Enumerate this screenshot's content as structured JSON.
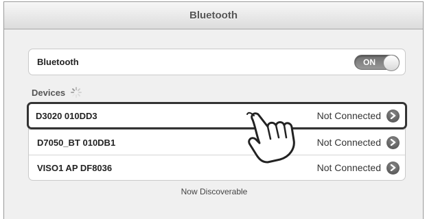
{
  "nav": {
    "title": "Bluetooth"
  },
  "bluetooth": {
    "label": "Bluetooth",
    "toggle_label": "ON",
    "enabled": true
  },
  "devices_header": "Devices",
  "devices": [
    {
      "name": "D3020 010DD3",
      "status": "Not Connected"
    },
    {
      "name": "D7050_BT 010DB1",
      "status": "Not Connected"
    },
    {
      "name": "VISO1 AP DF8036",
      "status": "Not Connected"
    }
  ],
  "footer": "Now Discoverable",
  "icons": {
    "detail": "chevron-right-circle-icon",
    "spinner": "loading-spinner-icon",
    "hand": "pointing-hand-icon"
  }
}
